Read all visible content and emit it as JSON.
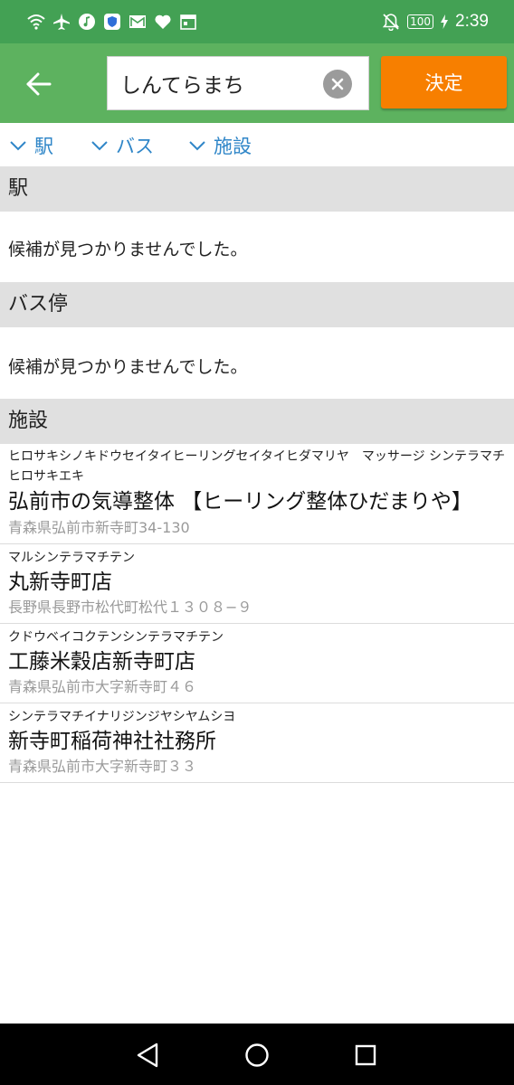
{
  "status_bar": {
    "battery": "100",
    "time": "2:39"
  },
  "search": {
    "query": "しんてらまち",
    "decide_label": "決定"
  },
  "filters": [
    {
      "label": "駅"
    },
    {
      "label": "バス"
    },
    {
      "label": "施設"
    }
  ],
  "sections": {
    "station": {
      "title": "駅",
      "empty": "候補が見つかりませんでした。"
    },
    "bus": {
      "title": "バス停",
      "empty": "候補が見つかりませんでした。"
    },
    "facility": {
      "title": "施設"
    }
  },
  "facilities": [
    {
      "kana": "ヒロサキシノキドウセイタイヒーリングセイタイヒダマリヤ　マッサージ シンテラマチ　ヒロサキエキ",
      "name": "弘前市の気導整体 【ヒーリング整体ひだまりや】",
      "address": "青森県弘前市新寺町34-130"
    },
    {
      "kana": "マルシンテラマチテン",
      "name": "丸新寺町店",
      "address": "長野県長野市松代町松代１３０８−９"
    },
    {
      "kana": "クドウベイコクテンシンテラマチテン",
      "name": "工藤米穀店新寺町店",
      "address": "青森県弘前市大字新寺町４６"
    },
    {
      "kana": "シンテラマチイナリジンジヤシヤムシヨ",
      "name": "新寺町稲荷神社社務所",
      "address": "青森県弘前市大字新寺町３３"
    }
  ],
  "colors": {
    "status_bar": "#43a154",
    "app_bar": "#5db25f",
    "accent_button": "#f77f00",
    "link_blue": "#2f86c8",
    "section_bg": "#e0e0e0"
  },
  "icons": {
    "back": "arrow-left-icon",
    "clear": "clear-circle-icon",
    "filter": "chevron-down-icon",
    "nav": [
      "back-triangle-icon",
      "home-circle-icon",
      "recents-square-icon"
    ]
  }
}
